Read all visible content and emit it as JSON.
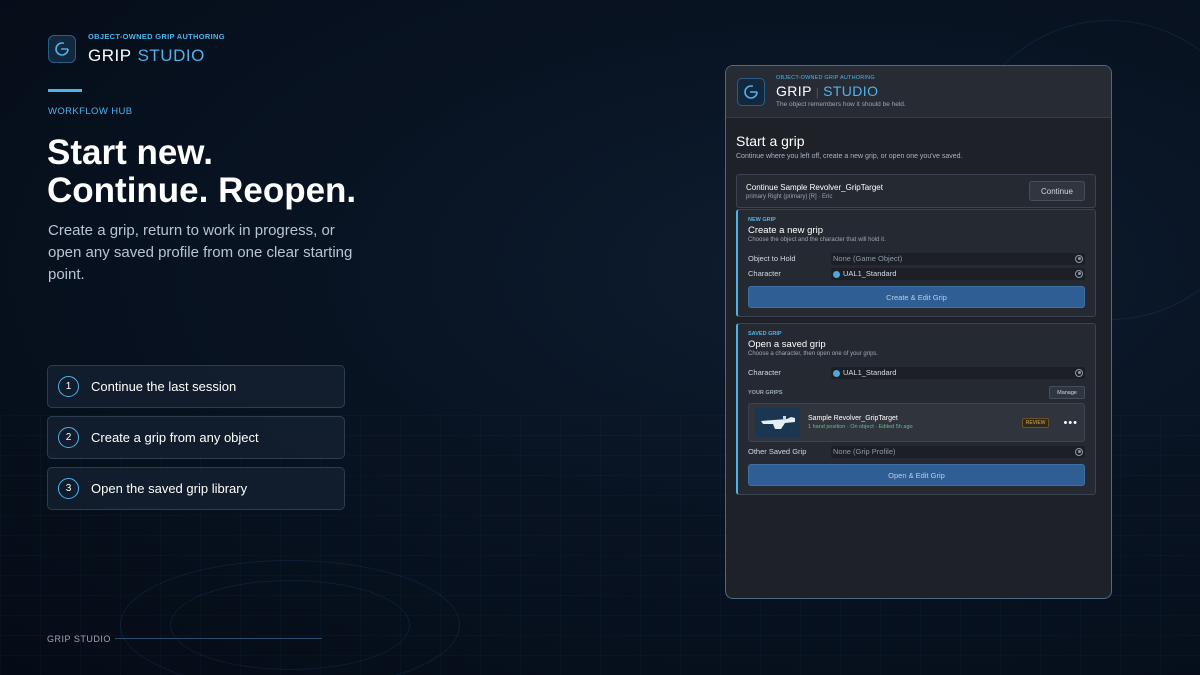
{
  "brand": {
    "eyebrow": "OBJECT-OWNED GRIP AUTHORING",
    "name_main": "GRIP",
    "name_accent": "STUDIO"
  },
  "hero": {
    "hub_label": "WORKFLOW HUB",
    "title_line1": "Start new.",
    "title_line2": "Continue. Reopen.",
    "subtitle": "Create a grip, return to work in progress, or open any saved profile from one clear starting point."
  },
  "steps": [
    {
      "num": "1",
      "label": "Continue the last session"
    },
    {
      "num": "2",
      "label": "Create a grip from any object"
    },
    {
      "num": "3",
      "label": "Open the saved grip library"
    }
  ],
  "footer": {
    "label": "GRIP STUDIO"
  },
  "window": {
    "eyebrow": "OBJECT-OWNED GRIP AUTHORING",
    "title_main": "GRIP",
    "title_sep": "|",
    "title_accent": "STUDIO",
    "tagline": "The object remembers how it should be held.",
    "start_title": "Start a grip",
    "start_sub": "Continue where you left off, create a new grip, or open one you've saved.",
    "continue_card": {
      "title": "Continue Sample Revolver_GripTarget",
      "sub": "primary Right (primary) [R] · Eric",
      "button": "Continue"
    },
    "new_grip": {
      "eyebrow": "NEW GRIP",
      "title": "Create a new grip",
      "sub": "Choose the object and the character that will hold it.",
      "object_label": "Object to Hold",
      "object_value": "None (Game Object)",
      "character_label": "Character",
      "character_value": "UAL1_Standard",
      "button": "Create & Edit Grip"
    },
    "saved_grip": {
      "eyebrow": "SAVED GRIP",
      "title": "Open a saved grip",
      "sub": "Choose a character, then open one of your grips.",
      "character_label": "Character",
      "character_value": "UAL1_Standard",
      "your_grips_label": "YOUR GRIPS",
      "manage_button": "Manage",
      "grip": {
        "name": "Sample Revolver_GripTarget",
        "meta": "1 hand position · On object · Edited 5h ago",
        "badge": "REVIEW",
        "more": "•••"
      },
      "other_label": "Other Saved Grip",
      "other_value": "None (Grip Profile)",
      "button": "Open & Edit Grip"
    }
  }
}
